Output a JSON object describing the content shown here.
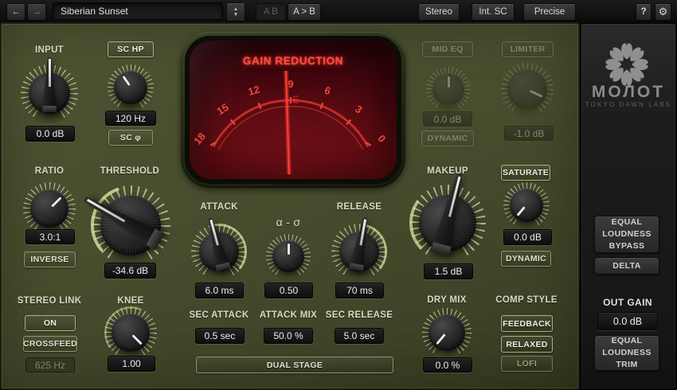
{
  "colors": {
    "panel_olive": "#474d2d",
    "meter_bg_red": "#5e0c13",
    "meter_accent": "#ff4a40",
    "tick_olive": "#dae0b6",
    "side_panel": "#1d1d1d"
  },
  "titlebar": {
    "back_icon": "←",
    "forward_icon": "→",
    "preset": {
      "name": "Siberian Sunset"
    },
    "spinner_up_icon": "▲",
    "spinner_down_icon": "▼",
    "ab_label": "A B",
    "a_to_b_label": "A > B",
    "channel_mode_label": "Stereo",
    "sidechain_label": "Int. SC",
    "quality_label": "Precise",
    "help_label": "?",
    "settings_icon": "⚙"
  },
  "meter": {
    "title": "GAIN REDUCTION",
    "scale_labels": [
      "18",
      "15",
      "12",
      "9",
      "6",
      "3",
      "0"
    ]
  },
  "controls": {
    "input": {
      "label": "INPUT",
      "value": "0.0 dB"
    },
    "sc_hp": {
      "button": "SC HP",
      "value": "120 Hz",
      "phase_button": "SC φ"
    },
    "ratio": {
      "label": "RATIO",
      "value": "3.0:1",
      "inverse_button": "INVERSE"
    },
    "threshold": {
      "label": "THRESHOLD",
      "value": "-34.6 dB"
    },
    "stereo_link": {
      "label": "STEREO LINK",
      "on_button": "ON",
      "crossfeed_button": "CROSSFEED",
      "crossfeed_value": "625 Hz"
    },
    "knee": {
      "label": "KNEE",
      "value": "1.00"
    },
    "attack": {
      "label": "ATTACK",
      "value": "6.0 ms"
    },
    "alpha_sigma": {
      "label": "α - σ",
      "value": "0.50"
    },
    "release": {
      "label": "RELEASE",
      "value": "70 ms"
    },
    "sec_attack": {
      "label": "SEC ATTACK",
      "value": "0.5 sec"
    },
    "attack_mix": {
      "label": "ATTACK MIX",
      "value": "50.0 %"
    },
    "sec_release": {
      "label": "SEC RELEASE",
      "value": "5.0 sec"
    },
    "dual_stage_button": "DUAL STAGE",
    "mid_eq": {
      "button": "MID EQ",
      "value": "0.0 dB",
      "dynamic_button": "DYNAMIC"
    },
    "limiter": {
      "button": "LIMITER",
      "value": "-1.0 dB"
    },
    "makeup": {
      "label": "MAKEUP",
      "value": "1.5 dB"
    },
    "saturate": {
      "button": "SATURATE",
      "value": "0.0 dB",
      "dynamic_button": "DYNAMIC"
    },
    "dry_mix": {
      "label": "DRY MIX",
      "value": "0.0 %"
    },
    "comp_style": {
      "label": "COMP STYLE",
      "options": [
        "FEEDBACK",
        "RELAXED",
        "LOFI"
      ]
    }
  },
  "branding": {
    "logo_text": "МОЛОТ",
    "company": "TOKYO DAWN LABS"
  },
  "output_section": {
    "bypass_button": "EQUAL LOUDNESS BYPASS",
    "delta_button": "DELTA",
    "out_gain_label": "OUT GAIN",
    "out_gain_value": "0.0 dB",
    "trim_button": "EQUAL LOUDNESS TRIM"
  }
}
